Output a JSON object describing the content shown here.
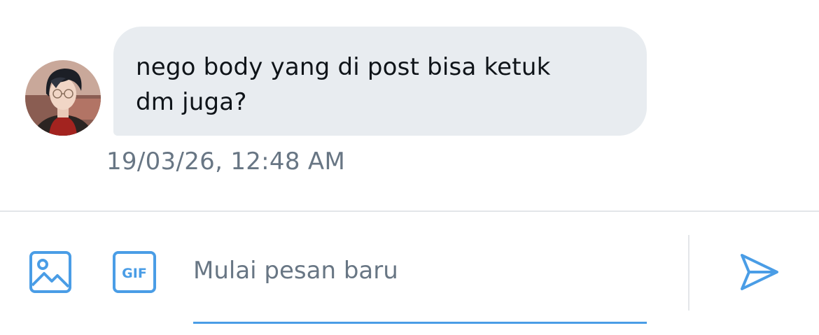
{
  "conversation": {
    "message": {
      "text": "nego body yang di post bisa ketuk\ndm juga?",
      "timestamp": "19/03/26, 12:48 AM"
    }
  },
  "composer": {
    "placeholder": "Mulai pesan baru",
    "icons": {
      "image": "image-icon",
      "gif": "gif-icon",
      "send": "send-icon"
    },
    "gif_label": "GIF"
  },
  "colors": {
    "accent": "#4a9de6",
    "bubble_bg": "#e8ecf0",
    "muted_text": "#687684",
    "primary_text": "#0f1419",
    "divider": "#e3e6e9"
  }
}
